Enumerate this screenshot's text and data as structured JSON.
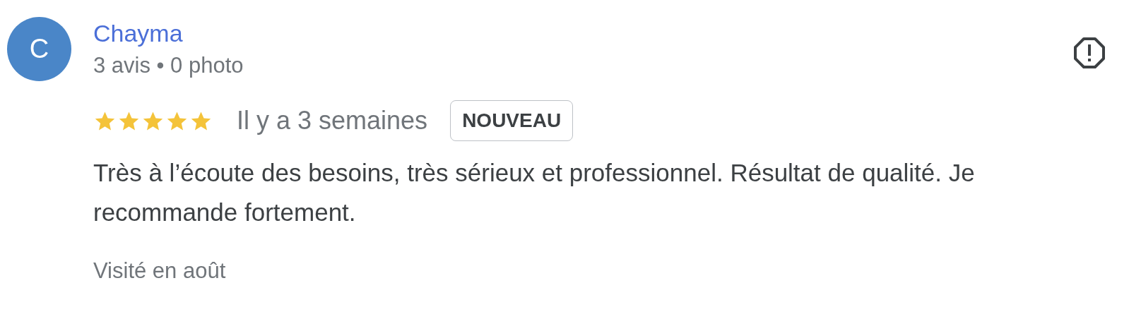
{
  "review": {
    "avatar_letter": "C",
    "author": "Chayma",
    "author_meta": "3 avis • 0 photo",
    "stars": 5,
    "time": "Il y a 3 semaines",
    "badge": "NOUVEAU",
    "text": "Très à l’écoute des besoins, très sérieux et professionnel. Résultat de qualité. Je recommande fortement.",
    "visited": "Visité en août"
  }
}
